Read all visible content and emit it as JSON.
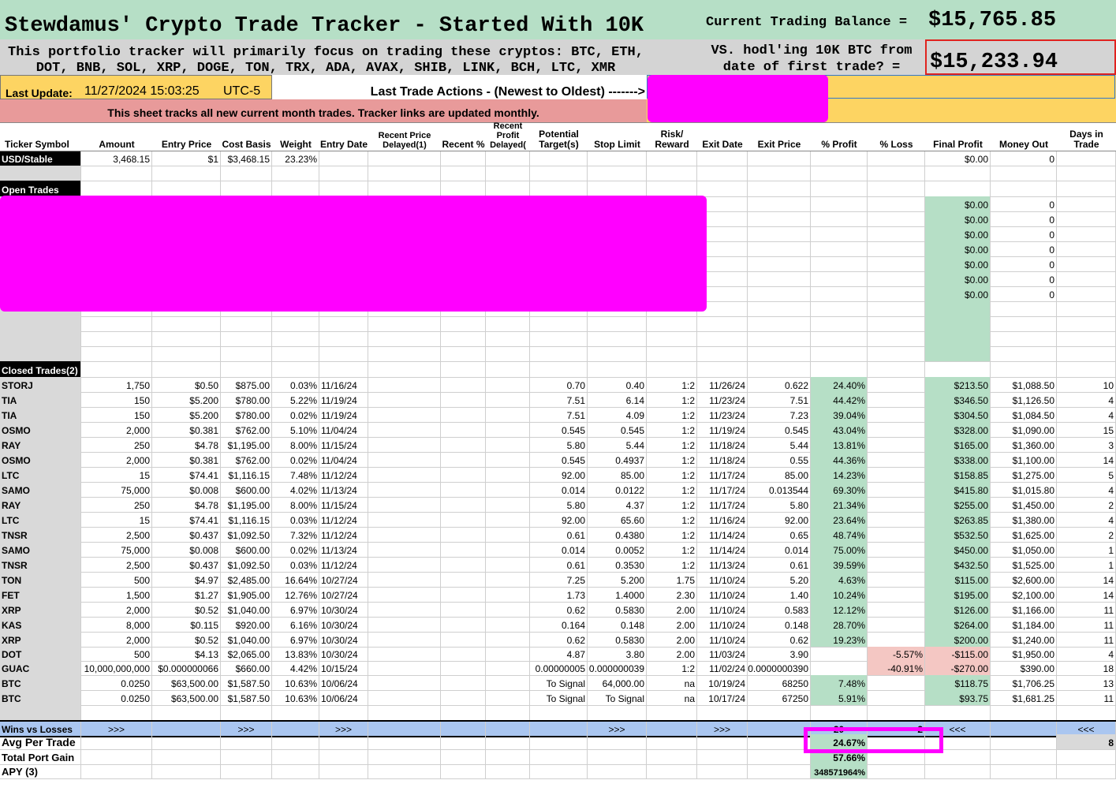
{
  "header": {
    "title": "Stewdamus' Crypto Trade Tracker - Started With 10K",
    "balance_label": "Current Trading Balance =",
    "balance_value": "$15,765.85",
    "subtitle_line1": "This portfolio tracker will primarily focus on trading these cryptos: BTC, ETH,",
    "subtitle_line2": "DOT, BNB, SOL, XRP, DOGE, TON, TRX, ADA, AVAX, SHIB, LINK, BCH, LTC, XMR",
    "hodl_line1": "VS. hodl'ing 10K BTC from",
    "hodl_line2": "date of first trade? =",
    "hodl_value": "$15,233.94",
    "update_label": "Last Update:",
    "update_value": "11/27/2024 15:03:25",
    "update_tz": "UTC-5",
    "actions_label": "Last Trade Actions - (Newest to Oldest) ------->",
    "month_note": "This sheet tracks all new current month trades. Tracker links are updated monthly."
  },
  "columns": [
    {
      "key": "ticker",
      "label": "Ticker Symbol"
    },
    {
      "key": "amount",
      "label": "Amount"
    },
    {
      "key": "entry_price",
      "label": "Entry Price"
    },
    {
      "key": "cost_basis",
      "label": "Cost Basis"
    },
    {
      "key": "weight",
      "label": "Weight"
    },
    {
      "key": "entry_date",
      "label": "Entry Date"
    },
    {
      "key": "recent_price",
      "label": "Recent Price Delayed(1)"
    },
    {
      "key": "recent_pct",
      "label": "Recent %"
    },
    {
      "key": "recent_profit",
      "label": "Recent Profit Delayed("
    },
    {
      "key": "target",
      "label": "Potential Target(s)"
    },
    {
      "key": "stop",
      "label": "Stop Limit"
    },
    {
      "key": "rr",
      "label": "Risk/ Reward"
    },
    {
      "key": "exit_date",
      "label": "Exit Date"
    },
    {
      "key": "exit_price",
      "label": "Exit Price"
    },
    {
      "key": "pct_profit",
      "label": "% Profit"
    },
    {
      "key": "pct_loss",
      "label": "% Loss"
    },
    {
      "key": "final_profit",
      "label": "Final Profit"
    },
    {
      "key": "money_out",
      "label": "Money Out"
    },
    {
      "key": "days",
      "label": "Days in Trade"
    }
  ],
  "stable_row": {
    "ticker": "USD/Stable",
    "amount": "3,468.15",
    "entry_price": "$1",
    "cost_basis": "$3,468.15",
    "weight": "23.23%",
    "final_profit": "$0.00",
    "money_out": "0"
  },
  "open_trades_label": "Open Trades",
  "open_rows": [
    {
      "final_profit": "$0.00",
      "money_out": "0"
    },
    {
      "final_profit": "$0.00",
      "money_out": "0"
    },
    {
      "final_profit": "$0.00",
      "money_out": "0"
    },
    {
      "final_profit": "$0.00",
      "money_out": "0"
    },
    {
      "final_profit": "$0.00",
      "money_out": "0"
    },
    {
      "final_profit": "$0.00",
      "money_out": "0"
    },
    {
      "final_profit": "$0.00",
      "money_out": "0"
    }
  ],
  "closed_trades_label": "Closed Trades(2)",
  "closed_rows": [
    {
      "ticker": "STORJ",
      "amount": "1,750",
      "entry_price": "$0.50",
      "cost_basis": "$875.00",
      "weight": "0.03%",
      "entry_date": "11/16/24",
      "target": "0.70",
      "stop": "0.40",
      "rr": "1:2",
      "exit_date": "11/26/24",
      "exit_price": "0.622",
      "pct_profit": "24.40%",
      "pct_loss": "",
      "final_profit": "$213.50",
      "money_out": "$1,088.50",
      "days": "10"
    },
    {
      "ticker": "TIA",
      "amount": "150",
      "entry_price": "$5.200",
      "cost_basis": "$780.00",
      "weight": "5.22%",
      "entry_date": "11/19/24",
      "target": "7.51",
      "stop": "6.14",
      "rr": "1:2",
      "exit_date": "11/23/24",
      "exit_price": "7.51",
      "pct_profit": "44.42%",
      "pct_loss": "",
      "final_profit": "$346.50",
      "money_out": "$1,126.50",
      "days": "4"
    },
    {
      "ticker": "TIA",
      "amount": "150",
      "entry_price": "$5.200",
      "cost_basis": "$780.00",
      "weight": "0.02%",
      "entry_date": "11/19/24",
      "target": "7.51",
      "stop": "4.09",
      "rr": "1:2",
      "exit_date": "11/23/24",
      "exit_price": "7.23",
      "pct_profit": "39.04%",
      "pct_loss": "",
      "final_profit": "$304.50",
      "money_out": "$1,084.50",
      "days": "4"
    },
    {
      "ticker": "OSMO",
      "amount": "2,000",
      "entry_price": "$0.381",
      "cost_basis": "$762.00",
      "weight": "5.10%",
      "entry_date": "11/04/24",
      "target": "0.545",
      "stop": "0.545",
      "rr": "1:2",
      "exit_date": "11/19/24",
      "exit_price": "0.545",
      "pct_profit": "43.04%",
      "pct_loss": "",
      "final_profit": "$328.00",
      "money_out": "$1,090.00",
      "days": "15"
    },
    {
      "ticker": "RAY",
      "amount": "250",
      "entry_price": "$4.78",
      "cost_basis": "$1,195.00",
      "weight": "8.00%",
      "entry_date": "11/15/24",
      "target": "5.80",
      "stop": "5.44",
      "rr": "1:2",
      "exit_date": "11/18/24",
      "exit_price": "5.44",
      "pct_profit": "13.81%",
      "pct_loss": "",
      "final_profit": "$165.00",
      "money_out": "$1,360.00",
      "days": "3"
    },
    {
      "ticker": "OSMO",
      "amount": "2,000",
      "entry_price": "$0.381",
      "cost_basis": "$762.00",
      "weight": "0.02%",
      "entry_date": "11/04/24",
      "target": "0.545",
      "stop": "0.4937",
      "rr": "1:2",
      "exit_date": "11/18/24",
      "exit_price": "0.55",
      "pct_profit": "44.36%",
      "pct_loss": "",
      "final_profit": "$338.00",
      "money_out": "$1,100.00",
      "days": "14"
    },
    {
      "ticker": "LTC",
      "amount": "15",
      "entry_price": "$74.41",
      "cost_basis": "$1,116.15",
      "weight": "7.48%",
      "entry_date": "11/12/24",
      "target": "92.00",
      "stop": "85.00",
      "rr": "1:2",
      "exit_date": "11/17/24",
      "exit_price": "85.00",
      "pct_profit": "14.23%",
      "pct_loss": "",
      "final_profit": "$158.85",
      "money_out": "$1,275.00",
      "days": "5"
    },
    {
      "ticker": "SAMO",
      "amount": "75,000",
      "entry_price": "$0.008",
      "cost_basis": "$600.00",
      "weight": "4.02%",
      "entry_date": "11/13/24",
      "target": "0.014",
      "stop": "0.0122",
      "rr": "1:2",
      "exit_date": "11/17/24",
      "exit_price": "0.013544",
      "pct_profit": "69.30%",
      "pct_loss": "",
      "final_profit": "$415.80",
      "money_out": "$1,015.80",
      "days": "4"
    },
    {
      "ticker": "RAY",
      "amount": "250",
      "entry_price": "$4.78",
      "cost_basis": "$1,195.00",
      "weight": "8.00%",
      "entry_date": "11/15/24",
      "target": "5.80",
      "stop": "4.37",
      "rr": "1:2",
      "exit_date": "11/17/24",
      "exit_price": "5.80",
      "pct_profit": "21.34%",
      "pct_loss": "",
      "final_profit": "$255.00",
      "money_out": "$1,450.00",
      "days": "2"
    },
    {
      "ticker": "LTC",
      "amount": "15",
      "entry_price": "$74.41",
      "cost_basis": "$1,116.15",
      "weight": "0.03%",
      "entry_date": "11/12/24",
      "target": "92.00",
      "stop": "65.60",
      "rr": "1:2",
      "exit_date": "11/16/24",
      "exit_price": "92.00",
      "pct_profit": "23.64%",
      "pct_loss": "",
      "final_profit": "$263.85",
      "money_out": "$1,380.00",
      "days": "4"
    },
    {
      "ticker": "TNSR",
      "amount": "2,500",
      "entry_price": "$0.437",
      "cost_basis": "$1,092.50",
      "weight": "7.32%",
      "entry_date": "11/12/24",
      "target": "0.61",
      "stop": "0.4380",
      "rr": "1:2",
      "exit_date": "11/14/24",
      "exit_price": "0.65",
      "pct_profit": "48.74%",
      "pct_loss": "",
      "final_profit": "$532.50",
      "money_out": "$1,625.00",
      "days": "2"
    },
    {
      "ticker": "SAMO",
      "amount": "75,000",
      "entry_price": "$0.008",
      "cost_basis": "$600.00",
      "weight": "0.02%",
      "entry_date": "11/13/24",
      "target": "0.014",
      "stop": "0.0052",
      "rr": "1:2",
      "exit_date": "11/14/24",
      "exit_price": "0.014",
      "pct_profit": "75.00%",
      "pct_loss": "",
      "final_profit": "$450.00",
      "money_out": "$1,050.00",
      "days": "1"
    },
    {
      "ticker": "TNSR",
      "amount": "2,500",
      "entry_price": "$0.437",
      "cost_basis": "$1,092.50",
      "weight": "0.03%",
      "entry_date": "11/12/24",
      "target": "0.61",
      "stop": "0.3530",
      "rr": "1:2",
      "exit_date": "11/13/24",
      "exit_price": "0.61",
      "pct_profit": "39.59%",
      "pct_loss": "",
      "final_profit": "$432.50",
      "money_out": "$1,525.00",
      "days": "1"
    },
    {
      "ticker": "TON",
      "amount": "500",
      "entry_price": "$4.97",
      "cost_basis": "$2,485.00",
      "weight": "16.64%",
      "entry_date": "10/27/24",
      "target": "7.25",
      "stop": "5.200",
      "rr": "1.75",
      "exit_date": "11/10/24",
      "exit_price": "5.20",
      "pct_profit": "4.63%",
      "pct_loss": "",
      "final_profit": "$115.00",
      "money_out": "$2,600.00",
      "days": "14"
    },
    {
      "ticker": "FET",
      "amount": "1,500",
      "entry_price": "$1.27",
      "cost_basis": "$1,905.00",
      "weight": "12.76%",
      "entry_date": "10/27/24",
      "target": "1.73",
      "stop": "1.4000",
      "rr": "2.30",
      "exit_date": "11/10/24",
      "exit_price": "1.40",
      "pct_profit": "10.24%",
      "pct_loss": "",
      "final_profit": "$195.00",
      "money_out": "$2,100.00",
      "days": "14"
    },
    {
      "ticker": "XRP",
      "amount": "2,000",
      "entry_price": "$0.52",
      "cost_basis": "$1,040.00",
      "weight": "6.97%",
      "entry_date": "10/30/24",
      "target": "0.62",
      "stop": "0.5830",
      "rr": "2.00",
      "exit_date": "11/10/24",
      "exit_price": "0.583",
      "pct_profit": "12.12%",
      "pct_loss": "",
      "final_profit": "$126.00",
      "money_out": "$1,166.00",
      "days": "11"
    },
    {
      "ticker": "KAS",
      "amount": "8,000",
      "entry_price": "$0.115",
      "cost_basis": "$920.00",
      "weight": "6.16%",
      "entry_date": "10/30/24",
      "target": "0.164",
      "stop": "0.148",
      "rr": "2.00",
      "exit_date": "11/10/24",
      "exit_price": "0.148",
      "pct_profit": "28.70%",
      "pct_loss": "",
      "final_profit": "$264.00",
      "money_out": "$1,184.00",
      "days": "11"
    },
    {
      "ticker": "XRP",
      "amount": "2,000",
      "entry_price": "$0.52",
      "cost_basis": "$1,040.00",
      "weight": "6.97%",
      "entry_date": "10/30/24",
      "target": "0.62",
      "stop": "0.5830",
      "rr": "2.00",
      "exit_date": "11/10/24",
      "exit_price": "0.62",
      "pct_profit": "19.23%",
      "pct_loss": "",
      "final_profit": "$200.00",
      "money_out": "$1,240.00",
      "days": "11"
    },
    {
      "ticker": "DOT",
      "amount": "500",
      "entry_price": "$4.13",
      "cost_basis": "$2,065.00",
      "weight": "13.83%",
      "entry_date": "10/30/24",
      "target": "4.87",
      "stop": "3.80",
      "rr": "2.00",
      "exit_date": "11/03/24",
      "exit_price": "3.90",
      "pct_profit": "",
      "pct_loss": "-5.57%",
      "final_profit": "-$115.00",
      "money_out": "$1,950.00",
      "days": "4"
    },
    {
      "ticker": "GUAC",
      "amount": "10,000,000,000",
      "entry_price": "$0.000000066",
      "cost_basis": "$660.00",
      "weight": "4.42%",
      "entry_date": "10/15/24",
      "target": "0.00000005",
      "stop": "0.000000039",
      "rr": "1:2",
      "exit_date": "11/02/24",
      "exit_price": "0.0000000390",
      "pct_profit": "",
      "pct_loss": "-40.91%",
      "final_profit": "-$270.00",
      "money_out": "$390.00",
      "days": "18"
    },
    {
      "ticker": "BTC",
      "amount": "0.0250",
      "entry_price": "$63,500.00",
      "cost_basis": "$1,587.50",
      "weight": "10.63%",
      "entry_date": "10/06/24",
      "target": "To Signal",
      "stop": "64,000.00",
      "rr": "na",
      "exit_date": "10/19/24",
      "exit_price": "68250",
      "pct_profit": "7.48%",
      "pct_loss": "",
      "final_profit": "$118.75",
      "money_out": "$1,706.25",
      "days": "13"
    },
    {
      "ticker": "BTC",
      "amount": "0.0250",
      "entry_price": "$63,500.00",
      "cost_basis": "$1,587.50",
      "weight": "10.63%",
      "entry_date": "10/06/24",
      "target": "To Signal",
      "stop": "To Signal",
      "rr": "na",
      "exit_date": "10/17/24",
      "exit_price": "67250",
      "pct_profit": "5.91%",
      "pct_loss": "",
      "final_profit": "$93.75",
      "money_out": "$1,681.25",
      "days": "11"
    }
  ],
  "summary": {
    "wins_label": "Wins vs Losses",
    "arrows_right": ">>>",
    "arrows_left": "<<<",
    "wins": "20",
    "losses": "2",
    "avg_label": "Avg Per Trade",
    "avg_value": "24.67%",
    "avg_days": "8",
    "gain_label": "Total Port Gain",
    "gain_value": "57.66%",
    "apy_label": "APY (3)",
    "apy_value": "348571964%"
  },
  "colors": {
    "green": "#b6dfc6",
    "yellow": "#fdd462",
    "pink_header": "#e89a9a",
    "loss": "#f4c7c3",
    "wins_bar": "#aac6f0",
    "redaction": "#ff00ff"
  }
}
